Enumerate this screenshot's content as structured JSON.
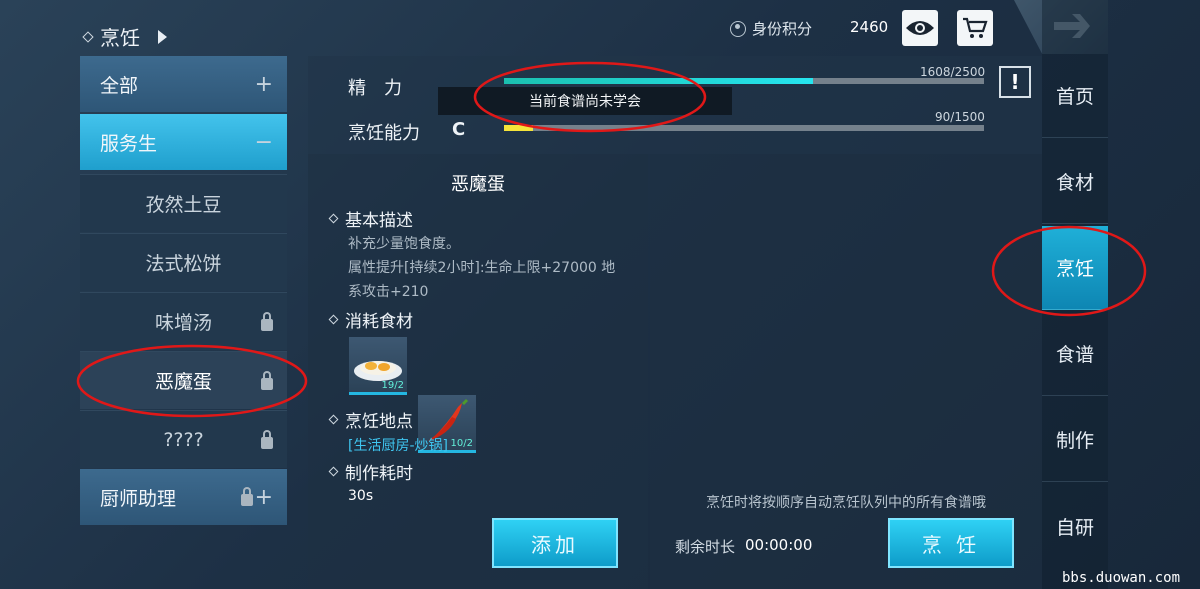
{
  "header": {
    "breadcrumb": "烹饪",
    "id_score_label": "身份积分",
    "score": "2460"
  },
  "icons": {
    "eye": "eye-icon",
    "cart": "cart-icon",
    "back_arrow": "arrow-right-icon",
    "id": "id-badge-icon",
    "lock": "lock-icon",
    "plus": "plus-icon",
    "minus": "minus-icon"
  },
  "stats": {
    "energy_label": "精　力",
    "energy_value": "1608/2500",
    "energy_fraction": 0.6432,
    "cooking_label": "烹饪能力",
    "cooking_grade": "C",
    "cooking_value": "90/1500",
    "cooking_fraction": 0.06,
    "tooltip": "当前食谱尚未学会",
    "alert": "!"
  },
  "categories": [
    {
      "label": "全部",
      "type": "header",
      "marker": "+"
    },
    {
      "label": "服务生",
      "type": "header",
      "marker": "−",
      "open": true
    },
    {
      "label": "孜然土豆",
      "type": "sub"
    },
    {
      "label": "法式松饼",
      "type": "sub"
    },
    {
      "label": "味增汤",
      "type": "sub",
      "locked": true
    },
    {
      "label": "恶魔蛋",
      "type": "sub",
      "locked": true,
      "selected": true
    },
    {
      "label": "????",
      "type": "sub",
      "locked": true
    },
    {
      "label": "厨师助理",
      "type": "header",
      "marker": "+",
      "locked": true
    }
  ],
  "detail": {
    "title": "恶魔蛋",
    "desc_heading": "基本描述",
    "desc_line1": "补充少量饱食度。",
    "desc_line2": "属性提升[持续2小时]:生命上限+27000 地",
    "desc_line3": "系攻击+210",
    "ingredients_heading": "消耗食材",
    "ingredients": [
      {
        "name": "egg",
        "count": "19/2"
      },
      {
        "name": "chili",
        "count": "10/2"
      }
    ],
    "location_heading": "烹饪地点",
    "location": "[生活厨房-炒锅]",
    "time_heading": "制作耗时",
    "time": "30s",
    "add_button": "添加"
  },
  "queue": {
    "hint": "烹饪时将按顺序自动烹饪队列中的所有食谱哦",
    "remaining_label": "剩余时长",
    "remaining_value": "00:00:00",
    "cook_button": "烹 饪"
  },
  "nav": [
    {
      "label": "首页"
    },
    {
      "label": "食材"
    },
    {
      "label": "烹饪",
      "active": true
    },
    {
      "label": "食谱"
    },
    {
      "label": "制作"
    },
    {
      "label": "自研"
    }
  ],
  "watermark": "bbs.duowan.com"
}
